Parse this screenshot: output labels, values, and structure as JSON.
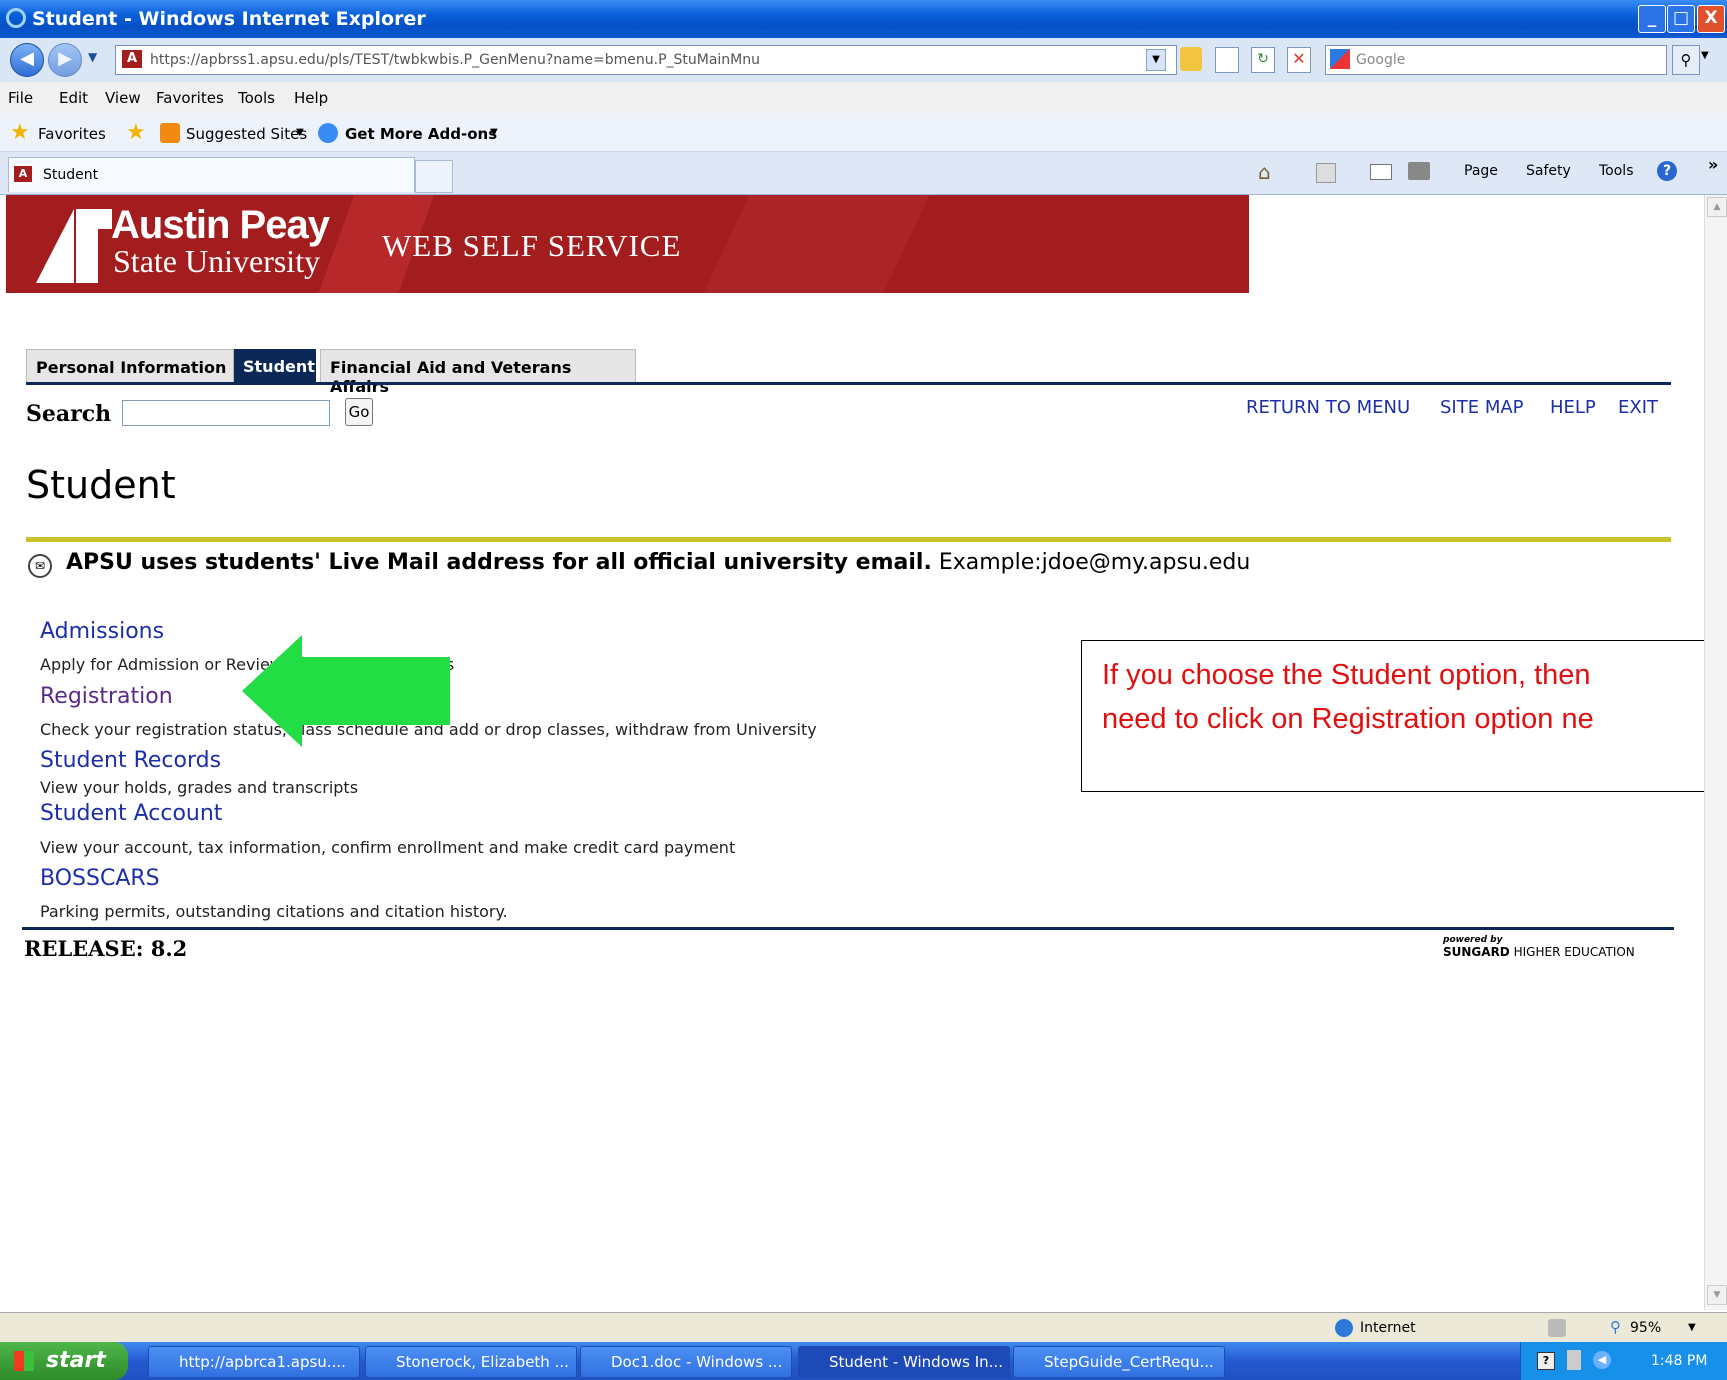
{
  "window": {
    "title": "Student - Windows Internet Explorer",
    "controls": [
      "_",
      "□",
      "X"
    ]
  },
  "address": {
    "url": "https://apbrss1.apsu.edu/pls/TEST/twbkwbis.P_GenMenu?name=bmenu.P_StuMainMnu",
    "search_placeholder": "Google"
  },
  "menu": [
    "File",
    "Edit",
    "View",
    "Favorites",
    "Tools",
    "Help"
  ],
  "favorites": {
    "label": "Favorites",
    "suggested": "Suggested Sites",
    "addons": "Get More Add-ons"
  },
  "tab": {
    "label": "Student"
  },
  "command_bar": {
    "page": "Page",
    "safety": "Safety",
    "tools": "Tools",
    "more": "»"
  },
  "banner": {
    "line1": "Austin Peay",
    "line2": "State University",
    "service": "WEB SELF SERVICE"
  },
  "site_tabs": [
    "Personal Information",
    "Student",
    "Financial Aid and Veterans Affairs"
  ],
  "search": {
    "label": "Search",
    "go": "Go"
  },
  "top_links": [
    "RETURN TO MENU",
    "SITE MAP",
    "HELP",
    "EXIT"
  ],
  "page_title": "Student",
  "notice": {
    "bold": "APSU uses students' Live Mail address for all official university email.",
    "rest": "Example:jdoe@my.apsu.edu"
  },
  "menu_items": [
    {
      "title": "Admissions",
      "desc": "Apply for Admission or Review Existing Applications"
    },
    {
      "title": "Registration",
      "desc": "Check your registration status, class schedule and add or drop classes, withdraw from University"
    },
    {
      "title": "Student Records",
      "desc": "View your holds, grades and transcripts"
    },
    {
      "title": "Student Account",
      "desc": "View your account, tax information, confirm enrollment and make credit card payment"
    },
    {
      "title": "BOSSCARS",
      "desc": "Parking permits, outstanding citations and citation history."
    }
  ],
  "release": "RELEASE: 8.2",
  "powered": {
    "small": "powered by",
    "brand": "SUNGARD",
    "rest": "HIGHER EDUCATION"
  },
  "callout": {
    "line1": "If you choose the Student option, then",
    "line2": "need to click on Registration option ne"
  },
  "status": {
    "zone": "Internet",
    "zoom": "95%"
  },
  "taskbar": {
    "start": "start",
    "items": [
      "http://apbrca1.apsu....",
      "Stonerock, Elizabeth ...",
      "Doc1.doc - Windows ...",
      "Student - Windows In...",
      "StepGuide_CertRequ..."
    ],
    "clock": "1:48 PM"
  },
  "colors": {
    "banner": "#a31d1f",
    "accent_rule": "#c8c32a",
    "link": "#1c2fa8",
    "callout_text": "#e01010",
    "arrow": "#22dd44"
  }
}
